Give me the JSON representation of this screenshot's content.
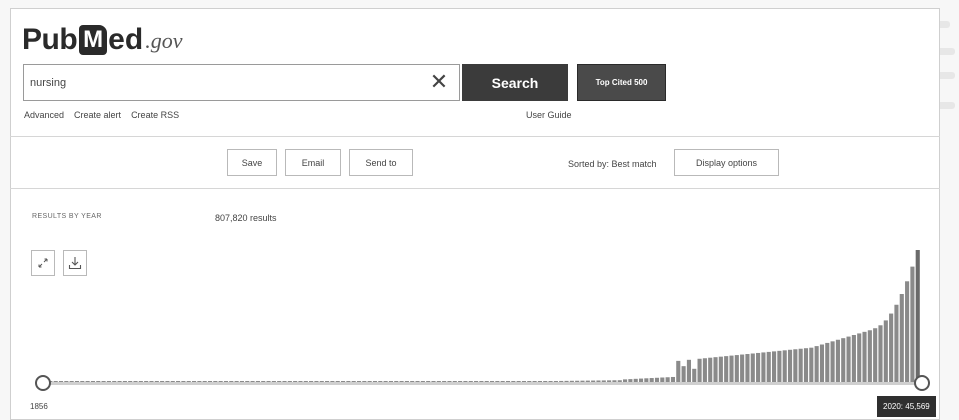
{
  "logo": {
    "pub": "Pub",
    "m": "M",
    "ed": "ed",
    "gov": ".gov"
  },
  "search": {
    "value": "nursing",
    "clear_glyph": "✕",
    "button_label": "Search",
    "top_cited_label": "Top Cited 500"
  },
  "sub_links": [
    "Advanced",
    "Create alert",
    "Create RSS"
  ],
  "user_guide": "User Guide",
  "actions": {
    "save": "Save",
    "email": "Email",
    "send_to": "Send to"
  },
  "sort": {
    "label": "Sorted by: Best match",
    "display_options": "Display options"
  },
  "results": {
    "by_year_label": "RESULTS BY YEAR",
    "count": "807,820 results"
  },
  "icons": {
    "expand": "expand-icon",
    "download": "download-icon"
  },
  "timeline": {
    "start_year": "1856",
    "end_label": "2020: 45,569"
  },
  "colors": {
    "bar": "#8a8a8a",
    "search_button": "#3b3b3b",
    "top_cited": "#4a4a4a"
  },
  "chart_data": {
    "type": "bar",
    "x_range": [
      1856,
      2020
    ],
    "annotated_points": [
      {
        "year": 2020,
        "count": 45569
      }
    ],
    "peak_year": 2020
  }
}
